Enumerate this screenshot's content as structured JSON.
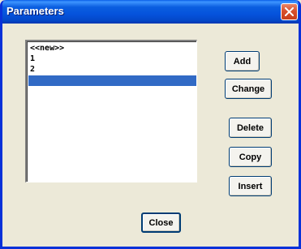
{
  "window": {
    "title": "Parameters",
    "close_icon": "close-icon"
  },
  "list": {
    "items": [
      "<<new>>",
      "1",
      "2",
      ""
    ],
    "selected_index": 3
  },
  "buttons": {
    "add": "Add",
    "change": "Change",
    "delete": "Delete",
    "copy": "Copy",
    "insert": "Insert",
    "close": "Close"
  },
  "colors": {
    "titlebar": "#0a5ee0",
    "selection": "#316ac5",
    "dialog_bg": "#ece9d8"
  }
}
